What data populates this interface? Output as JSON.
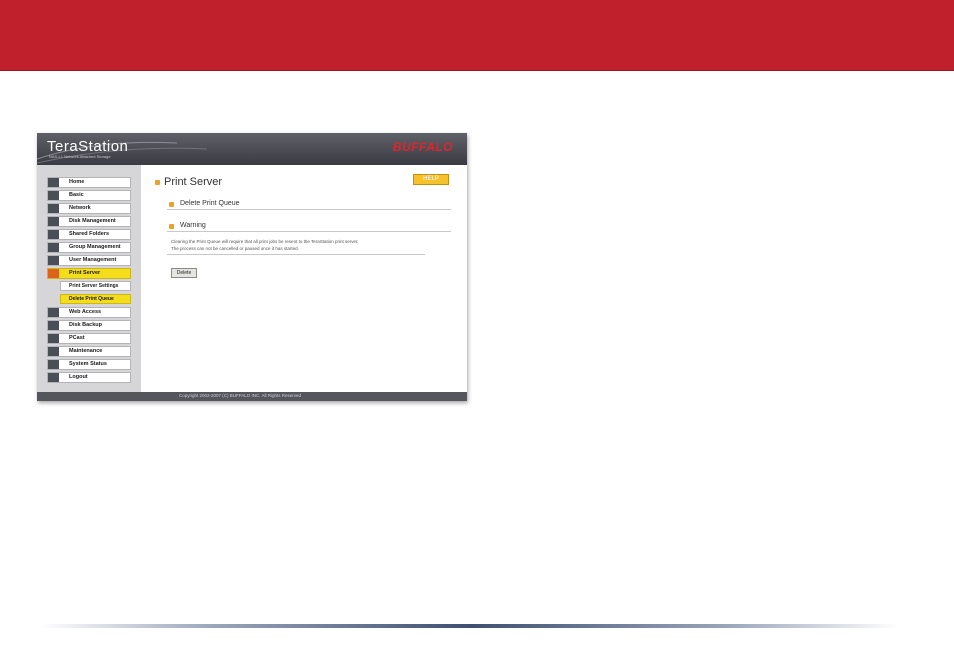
{
  "product": {
    "logo": "TeraStation",
    "subtitle": "NAS-L1 Network Attached Storage",
    "brand": "BUFFALO"
  },
  "sidebar": {
    "items": [
      {
        "label": "Home",
        "icon": "home-icon"
      },
      {
        "label": "Basic",
        "icon": "basic-icon"
      },
      {
        "label": "Network",
        "icon": "network-icon"
      },
      {
        "label": "Disk Management",
        "icon": "disk-icon"
      },
      {
        "label": "Shared Folders",
        "icon": "folder-icon"
      },
      {
        "label": "Group Management",
        "icon": "group-icon"
      },
      {
        "label": "User Management",
        "icon": "user-icon"
      },
      {
        "label": "Print Server",
        "icon": "printer-icon",
        "active": true
      },
      {
        "label": "Web Access",
        "icon": "web-icon"
      },
      {
        "label": "Disk Backup",
        "icon": "backup-icon"
      },
      {
        "label": "PCast",
        "icon": "pcast-icon"
      },
      {
        "label": "Maintenance",
        "icon": "maintenance-icon"
      },
      {
        "label": "System Status",
        "icon": "status-icon"
      },
      {
        "label": "Logout",
        "icon": "logout-icon"
      }
    ],
    "subitems": [
      {
        "label": "Print Server Settings"
      },
      {
        "label": "Delete Print Queue",
        "active": true
      }
    ]
  },
  "main": {
    "title": "Print Server",
    "help_label": "HELP",
    "section1": "Delete Print Queue",
    "section2": "Warning",
    "warning_line1": "Clearing the Print Queue will require that all print jobs be resent to the TeraStation print server.",
    "warning_line2": "The process can not be cancelled or paused once it has started.",
    "delete_label": "Delete"
  },
  "footer": {
    "copyright": "Copyright 2002-2007 (C) BUFFALO INC. All Rights Reserved"
  },
  "colors": {
    "banner": "#c0202c",
    "active_nav": "#f4de1c",
    "help": "#f5c22c",
    "brand": "#e0242d"
  }
}
